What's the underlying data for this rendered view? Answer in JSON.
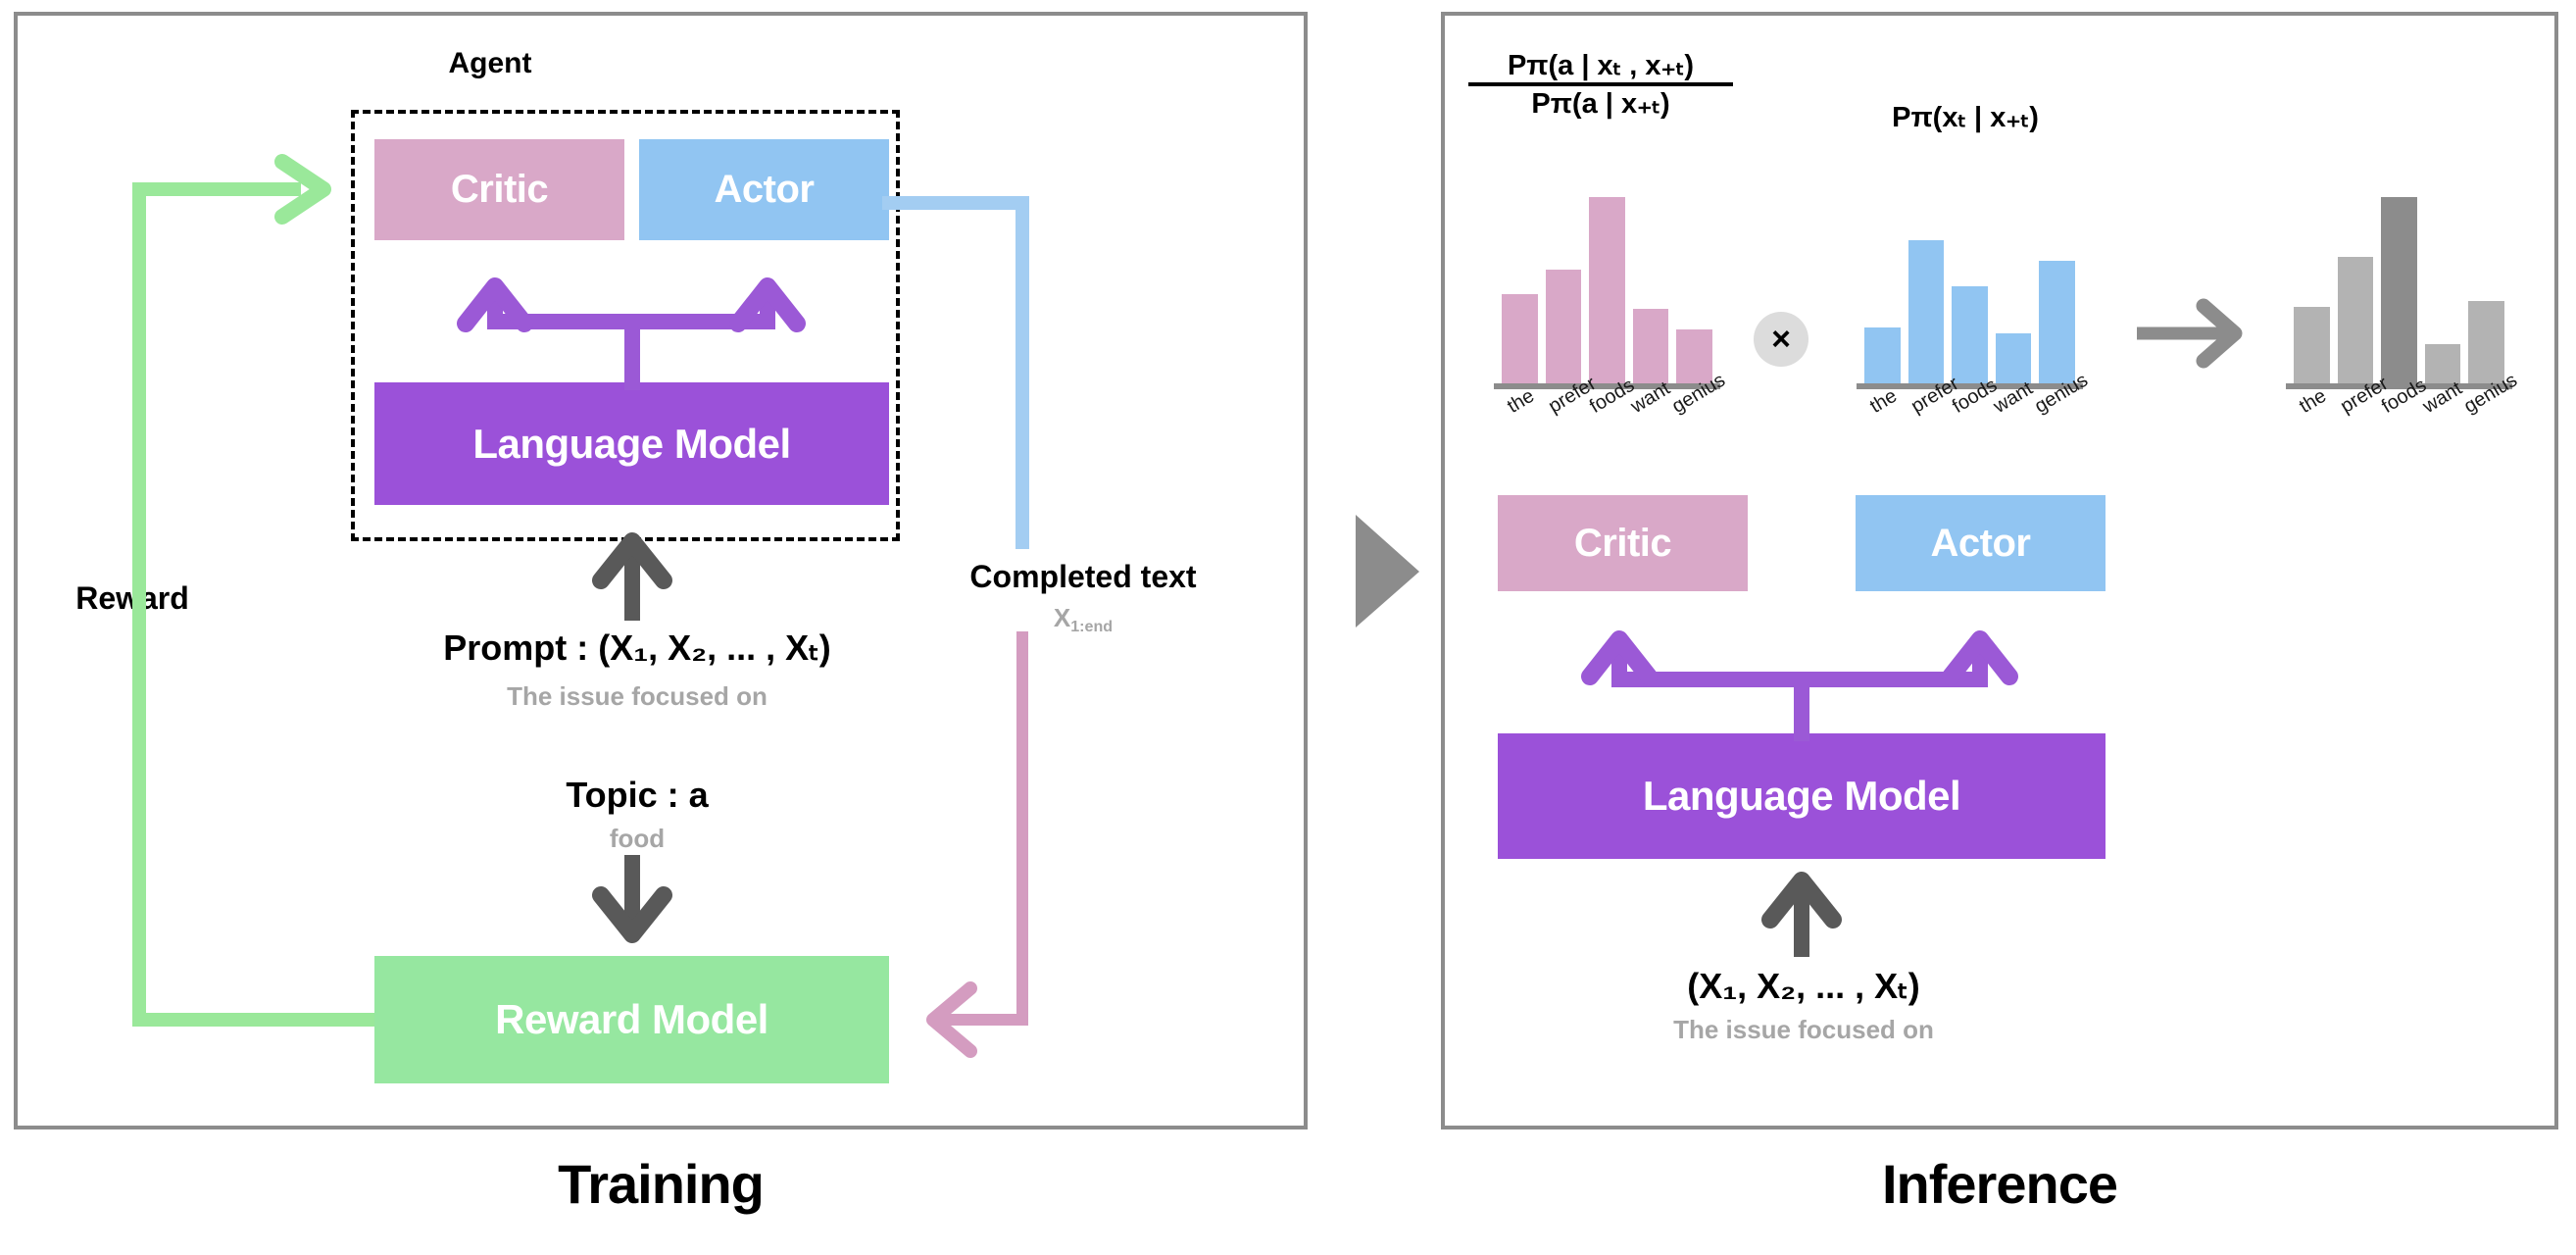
{
  "figure": {
    "left_panel_caption": "Training",
    "right_panel_caption": "Inference"
  },
  "training": {
    "agent_label": "Agent",
    "critic_label": "Critic",
    "actor_label": "Actor",
    "language_model_label": "Language Model",
    "reward_model_label": "Reward Model",
    "reward_arrow_label": "Reward",
    "completed_text_label": "Completed text",
    "completed_text_sub": "X",
    "completed_text_sub_index": "1:end",
    "prompt_label": "Prompt : (X",
    "prompt_full": "Prompt : (X₁, X₂, ... , Xₜ)",
    "prompt_sub_caption": "The issue focused on",
    "topic_label": "Topic : a",
    "topic_sub_caption": "food"
  },
  "inference": {
    "critic_label": "Critic",
    "actor_label": "Actor",
    "language_model_label": "Language Model",
    "input_label": "(X₁, X₂, ... , Xₜ)",
    "input_sub_caption": "The issue focused on",
    "times_symbol": "×",
    "critic_formula_numerator": "Pπ(a | xₜ , x₊ₜ)",
    "critic_formula_denominator": "Pπ(a | x₊ₜ)",
    "actor_formula": "Pπ(xₜ | x₊ₜ)"
  },
  "colors": {
    "critic": "#d9a8c8",
    "actor": "#91c5f2",
    "language_model": "#9b51d9",
    "reward_model": "#96e7a0",
    "reward_arrow": "#9ae89a",
    "completed_blue": "#a3cdf2",
    "completed_pink": "#d49cc0",
    "purple_arrow": "#9b59d6",
    "dark_arrow": "#595959",
    "axis_gray": "#8c8c8c",
    "bar_gray": "#b3b3b3",
    "bar_gray_highlight": "#8c8c8c",
    "panel_border": "#8c8c8c"
  },
  "chart_data": [
    {
      "type": "bar",
      "name": "critic-distribution",
      "title": "Pπ(a | xₜ , x₊ₜ) / Pπ(a | x₊ₜ)",
      "categories": [
        "the",
        "prefer",
        "foods",
        "want",
        "genius"
      ],
      "values": [
        48,
        61,
        100,
        40,
        29
      ],
      "ylim": [
        0,
        100
      ],
      "color": "#d9a8c8",
      "grid": false,
      "legend": "none"
    },
    {
      "type": "bar",
      "name": "actor-distribution",
      "title": "Pπ(xₜ | x₊ₜ)",
      "categories": [
        "the",
        "prefer",
        "foods",
        "want",
        "genius"
      ],
      "values": [
        30,
        77,
        52,
        27,
        66
      ],
      "ylim": [
        0,
        100
      ],
      "color": "#91c5f2",
      "grid": false,
      "legend": "none"
    },
    {
      "type": "bar",
      "name": "combined-distribution",
      "title": "",
      "categories": [
        "the",
        "prefer",
        "foods",
        "want",
        "genius"
      ],
      "values": [
        41,
        68,
        100,
        21,
        44
      ],
      "ylim": [
        0,
        100
      ],
      "color": "#b3b3b3",
      "highlight_index": 2,
      "highlight_color": "#8c8c8c",
      "grid": false,
      "legend": "none"
    }
  ]
}
